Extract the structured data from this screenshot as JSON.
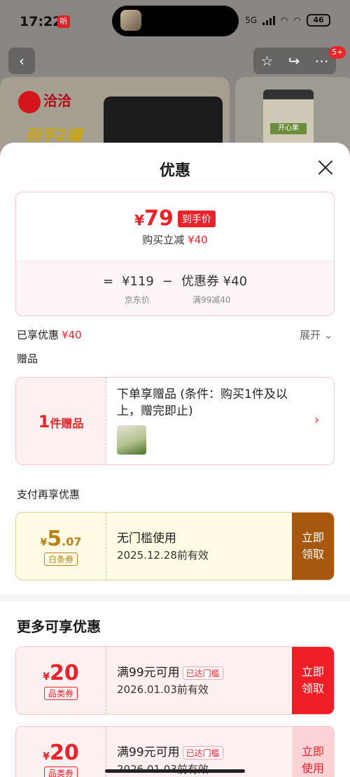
{
  "status": {
    "time": "17:22",
    "app_badge": "听",
    "network": "5G",
    "battery": "46"
  },
  "header": {
    "cart_badge": "5+"
  },
  "bg": {
    "brand": "洽洽",
    "promo": "到手2罐",
    "jar_label": "开心果"
  },
  "sheet": {
    "title": "优惠",
    "price": {
      "final_symbol": "¥",
      "final_amount": "79",
      "tag": "到手价",
      "reduce_label": "购买立减",
      "reduce_amount": "¥40",
      "eq": "=",
      "jd_price": "¥119",
      "minus": "−",
      "coupon_label": "优惠券 ¥40",
      "jd_label": "京东价",
      "coupon_cond": "满99减40"
    },
    "enjoyed": {
      "label": "已享优惠",
      "amount": "¥40",
      "expand": "展开"
    },
    "gift_section": "赠品",
    "gift": {
      "count": "1",
      "unit": "件赠品",
      "text": "下单享赠品 (条件：购买1件及以上，赠完即止)"
    },
    "pay_section": "支付再享优惠",
    "pay_coupon": {
      "symbol": "¥",
      "int": "5",
      "dec": ".07",
      "type": "白条券",
      "title": "无门槛使用",
      "date": "2025.12.28前有效",
      "button": "立即领取"
    },
    "more_title": "更多可享优惠",
    "coupons": [
      {
        "symbol": "¥",
        "amount": "20",
        "type": "品类券",
        "title": "满99元可用",
        "badge": "已达门槛",
        "date": "2026.01.03前有效",
        "button": "立即领取"
      },
      {
        "symbol": "¥",
        "amount": "20",
        "type": "品类券",
        "title": "满99元可用",
        "badge": "已达门槛",
        "date": "2026.01.03前有效",
        "button": "立即使用"
      }
    ]
  },
  "colors": {
    "accent": "#e8232a",
    "pay_button": "#a8570f",
    "pay_bg": "#fffbe4"
  }
}
